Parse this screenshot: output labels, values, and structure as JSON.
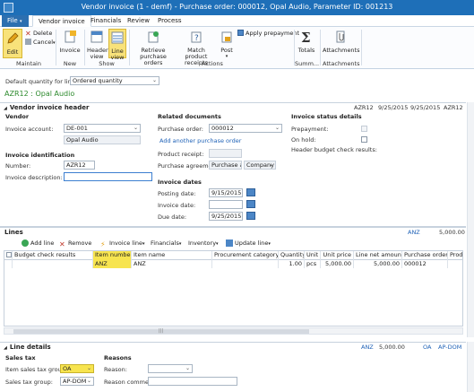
{
  "window": {
    "title": "Vendor invoice (1 - demf) - Purchase order: 000012, Opal Audio, Parameter ID: 001213"
  },
  "tabs": [
    {
      "label": "File"
    },
    {
      "label": "Vendor invoice"
    },
    {
      "label": "Financials"
    },
    {
      "label": "Review"
    },
    {
      "label": "Process"
    }
  ],
  "ribbon": {
    "edit": "Edit",
    "delete": "Delete",
    "cancel": "Cancel",
    "invoice": "Invoice",
    "header_view": "Header view",
    "line_view": "Line view",
    "retrieve_po": "Retrieve purchase orders",
    "match_receipts": "Match product receipts",
    "post": "Post",
    "apply_prepayment": "Apply prepayment",
    "totals": "Totals",
    "attachments": "Attachments",
    "groups": {
      "maintain": "Maintain",
      "new": "New",
      "show": "Show",
      "actions": "Actions",
      "summ": "Summ...",
      "attachments": "Attachments"
    }
  },
  "filter": {
    "default_qty_label": "Default quantity for lines:",
    "default_qty_value": "Ordered quantity"
  },
  "breadcrumb": "AZR12 : Opal Audio",
  "header_section": {
    "title": "Vendor invoice header",
    "summary": [
      "AZR12",
      "9/25/2015",
      "9/25/2015",
      "AZR12"
    ],
    "vendor": {
      "heading": "Vendor",
      "account_label": "Invoice account:",
      "account_value": "DE-001",
      "name_value": "Opal Audio"
    },
    "identification": {
      "heading": "Invoice identification",
      "number_label": "Number:",
      "number_value": "AZR12",
      "description_label": "Invoice description:",
      "description_value": ""
    },
    "related": {
      "heading": "Related documents",
      "po_label": "Purchase order:",
      "po_value": "000012",
      "add_po_link": "Add another purchase order",
      "receipt_label": "Product receipt:",
      "agreement_label": "Purchase agreement:",
      "agreement_value": "Purchase a",
      "company_value": "Company"
    },
    "dates": {
      "heading": "Invoice dates",
      "posting_label": "Posting date:",
      "posting_value": "9/15/2015",
      "invoice_label": "Invoice date:",
      "invoice_value": "",
      "due_label": "Due date:",
      "due_value": "9/25/2015"
    },
    "status": {
      "heading": "Invoice status details",
      "prepayment_label": "Prepayment:",
      "on_hold_label": "On hold:",
      "budget_label": "Header budget check results:"
    }
  },
  "lines_section": {
    "title": "Lines",
    "summary": [
      "ANZ",
      "5,000.00"
    ],
    "toolbar": {
      "add_line": "Add line",
      "remove": "Remove",
      "invoice_line": "Invoice line",
      "financials": "Financials",
      "inventory": "Inventory",
      "update_line": "Update line"
    },
    "columns": [
      "Budget check results",
      "Item number",
      "Item name",
      "Procurement category",
      "Quantity",
      "Unit",
      "Unit price",
      "Line net amount",
      "Purchase order",
      "Produ"
    ],
    "rows": [
      [
        "",
        "ANZ",
        "ANZ",
        "",
        "1.00",
        "pcs",
        "5,000.00",
        "5,000.00",
        "000012",
        ""
      ]
    ]
  },
  "line_details": {
    "title": "Line details",
    "summary": [
      "ANZ",
      "5,000.00",
      "OA",
      "AP-DOM"
    ],
    "sales_tax": {
      "heading": "Sales tax",
      "item_group_label": "Item sales tax group:",
      "item_group_value": "OA",
      "group_label": "Sales tax group:",
      "group_value": "AP-DOM"
    },
    "reasons": {
      "heading": "Reasons",
      "reason_label": "Reason:",
      "reason_value": "",
      "comment_label": "Reason comment:",
      "comment_value": ""
    }
  },
  "colors": {
    "titlebar": "#1e6fb8",
    "accent_green": "#2d8a2d",
    "link_blue": "#1f62b7",
    "highlight_yellow": "#f7e44f"
  }
}
